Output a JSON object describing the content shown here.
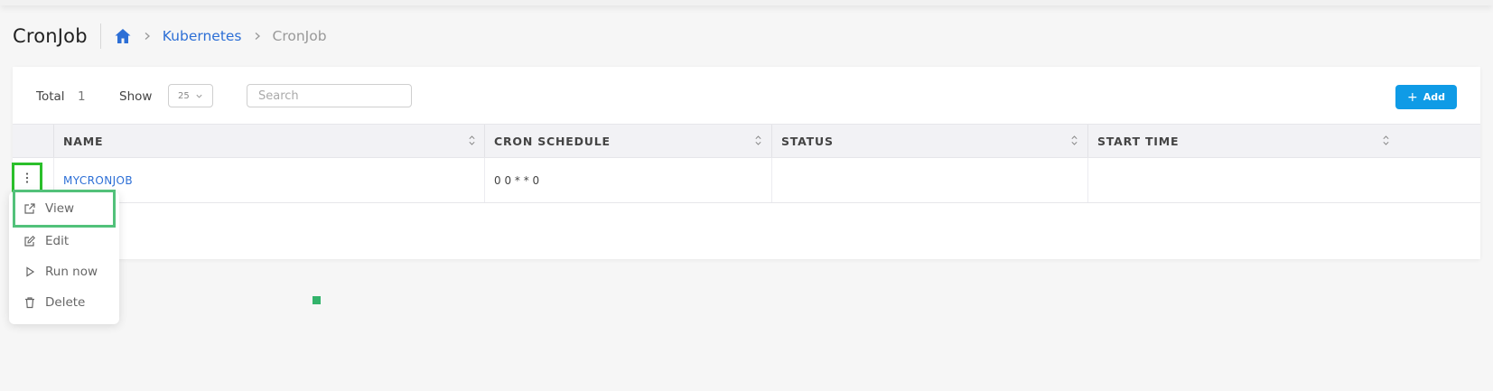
{
  "page": {
    "title": "CronJob"
  },
  "breadcrumb": {
    "home_icon": "home-icon",
    "items": [
      {
        "label": "Kubernetes"
      },
      {
        "label": "CronJob"
      }
    ]
  },
  "toolbar": {
    "total_label": "Total",
    "total_value": "1",
    "show_label": "Show",
    "show_value": "25",
    "search_placeholder": "Search",
    "add_label": "Add",
    "add_color": "#0f9be6"
  },
  "table": {
    "columns": [
      "NAME",
      "CRON SCHEDULE",
      "STATUS",
      "START TIME"
    ],
    "rows": [
      {
        "name": "MYCRONJOB",
        "cron_schedule": "0 0 * * 0",
        "status": "",
        "start_time": ""
      }
    ]
  },
  "row_menu": {
    "items": [
      {
        "label": "View",
        "icon": "external-link-icon"
      },
      {
        "label": "Edit",
        "icon": "edit-icon"
      },
      {
        "label": "Run now",
        "icon": "play-icon"
      },
      {
        "label": "Delete",
        "icon": "trash-icon"
      }
    ]
  },
  "colors": {
    "link": "#2d6fd6",
    "highlight": "#2bbf2b"
  }
}
